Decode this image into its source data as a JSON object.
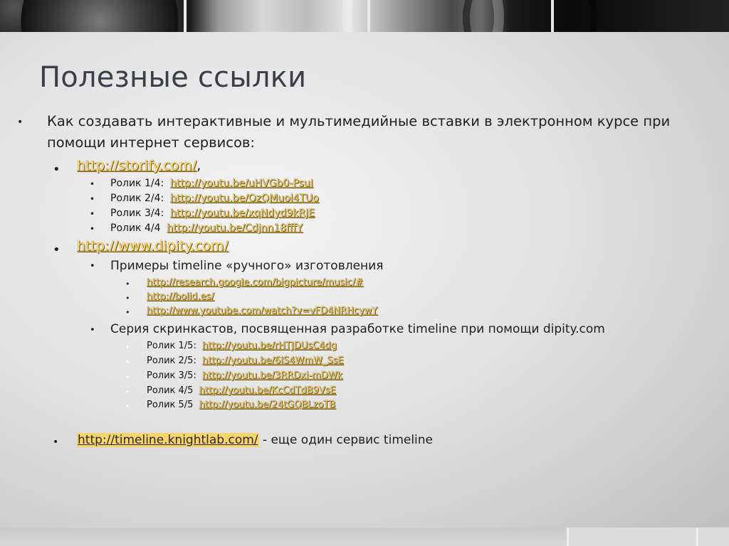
{
  "title": "Полезные ссылки",
  "intro": {
    "line1": "Как создавать интерактивные и мультимедийные вставки в электронном курсе при",
    "line2": "помощи интернет сервисов:"
  },
  "storify": {
    "url": "http://storify.com/",
    "suffix": ",",
    "videos": [
      {
        "label": "Ролик 1/4:",
        "url": "http://youtu.be/uHVGb0-PsuI"
      },
      {
        "label": "Ролик 2/4:",
        "url": "http://youtu.be/OzQMuol4TUo"
      },
      {
        "label": "Ролик 3/4:",
        "url": "http://youtu.be/xqNdyd9kRJE"
      },
      {
        "label": "Ролик 4/4",
        "url": "http://youtu.be/Cdjnn18fffY"
      }
    ]
  },
  "dipity": {
    "url": "http://www.dipity.com/",
    "manual_examples": {
      "label": "Примеры timeline «ручного» изготовления",
      "links": [
        "http://research.google.com/bigpicture/music/#",
        "http://bolid.es/",
        "http://www.youtube.com/watch?v=vFD4NRHcywY"
      ]
    },
    "screencasts": {
      "label": "Серия скринкастов, посвященная разработке timeline при помощи dipity.com",
      "videos": [
        {
          "label": "Ролик 1/5:",
          "url": "http://youtu.be/rHTJDUsC4dg"
        },
        {
          "label": "Ролик 2/5:",
          "url": "http://youtu.be/6IS4WmW_SsE"
        },
        {
          "label": "Ролик 3/5:",
          "url": "http://youtu.be/3RRDxi-mDWk"
        },
        {
          "label": "Ролик 4/5",
          "url": "http://youtu.be/KcCdTdB9VsE"
        },
        {
          "label": "Ролик 5/5",
          "url": "http://youtu.be/24tGQBLzoTB"
        }
      ]
    }
  },
  "knightlab": {
    "url": "http://timeline.knightlab.com/",
    "suffix": " - еще один сервис timeline"
  },
  "bullets": {
    "level1": "•",
    "level2": "•",
    "level3": "•",
    "level4": "•"
  }
}
